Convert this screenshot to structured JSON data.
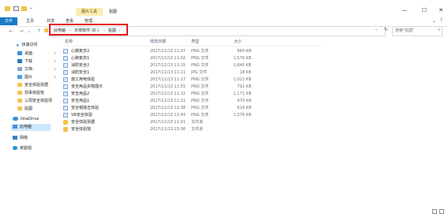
{
  "window": {
    "tool_tab": "图片工具",
    "title": "贴图",
    "minimize": "—",
    "maximize": "☐",
    "close": "✕"
  },
  "ribbon": {
    "tabs": [
      {
        "label": "文件",
        "active": true
      },
      {
        "label": "主页",
        "active": false
      },
      {
        "label": "共享",
        "active": false
      },
      {
        "label": "查看",
        "active": false
      },
      {
        "label": "管理",
        "active": false
      }
    ],
    "expand": "⌄",
    "help": "?"
  },
  "nav": {
    "back": "←",
    "forward": "→",
    "recent": "⌄",
    "up": "↑",
    "refresh": "↻"
  },
  "breadcrumb": {
    "items": [
      "此电脑",
      "日常软件 (D:)",
      "贴图"
    ],
    "sep": "›"
  },
  "search": {
    "placeholder": "搜索\"贴图\""
  },
  "sidebar": {
    "quick_access": "快速访问",
    "items": [
      {
        "label": "桌面",
        "pinned": true
      },
      {
        "label": "下载",
        "pinned": true
      },
      {
        "label": "文档",
        "pinned": true
      },
      {
        "label": "图片",
        "pinned": true
      },
      {
        "label": "安全体验票据",
        "pinned": false
      },
      {
        "label": "现事体验管",
        "pinned": false
      },
      {
        "label": "三周安全体验项",
        "pinned": false
      },
      {
        "label": "贴图",
        "pinned": false
      }
    ],
    "onedrive": "OneDrive",
    "this_pc": "此电脑",
    "network": "网络",
    "homegroup": "家庭组"
  },
  "columns": {
    "name": "名称",
    "date": "修改日期",
    "type": "类型",
    "size": "大小"
  },
  "files": [
    {
      "name": "心肺复苏2",
      "date": "2017/11/13 11:07",
      "type": "PNG 文件",
      "size": "660 KB",
      "kind": "png"
    },
    {
      "name": "心肺复苏1",
      "date": "2017/11/13 11:02",
      "type": "PNG 文件",
      "size": "1,579 KB",
      "kind": "png"
    },
    {
      "name": "消防安全2",
      "date": "2017/11/13 11:15",
      "type": "PNG 文件",
      "size": "1,640 KB",
      "kind": "png"
    },
    {
      "name": "消防安全1",
      "date": "2017/11/13 11:11",
      "type": "JPG 文件",
      "size": "18 KB",
      "kind": "png"
    },
    {
      "name": "施工用电体验",
      "date": "2017/11/13 11:27",
      "type": "PNG 文件",
      "size": "1,021 KB",
      "kind": "png"
    },
    {
      "name": "安全用品实物展示",
      "date": "2017/11/13 11:55",
      "type": "PNG 文件",
      "size": "791 KB",
      "kind": "png"
    },
    {
      "name": "安全用品2",
      "date": "2017/11/13 11:32",
      "type": "PNG 文件",
      "size": "1,171 KB",
      "kind": "png"
    },
    {
      "name": "安全用品1",
      "date": "2017/11/13 11:31",
      "type": "PNG 文件",
      "size": "970 KB",
      "kind": "png"
    },
    {
      "name": "安全帽撞击体验",
      "date": "2017/11/13 12:38",
      "type": "PNG 文件",
      "size": "614 KB",
      "kind": "png"
    },
    {
      "name": "VR安全体验",
      "date": "2017/11/13 12:43",
      "type": "PNG 文件",
      "size": "1,576 KB",
      "kind": "png"
    },
    {
      "name": "安全体验票据",
      "date": "2017/11/13 11:01",
      "type": "文件夹",
      "size": "",
      "kind": "folder"
    },
    {
      "name": "安全体验馆",
      "date": "2017/11/13 15:06",
      "type": "文件夹",
      "size": "",
      "kind": "folder"
    }
  ],
  "colors": {
    "accent": "#1979ca",
    "highlight": "#e8191c",
    "folder": "#f1c34b"
  }
}
